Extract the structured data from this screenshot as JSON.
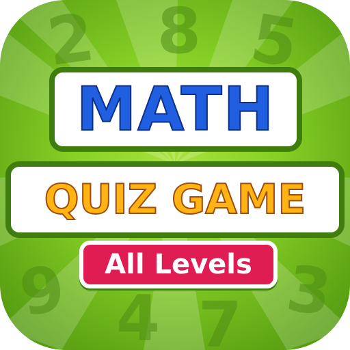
{
  "title": {
    "main": "MATH",
    "sub": "QUIZ GAME"
  },
  "badge": {
    "label": "All Levels"
  },
  "background_digits": [
    "2",
    "8",
    "5",
    "9",
    "4",
    "7",
    "3"
  ],
  "colors": {
    "background_green": "#86cf25",
    "panel_border": "#3f7e0e",
    "math_blue": "#1f5fe0",
    "quiz_orange": "#ffb413",
    "badge_red": "#df1d52"
  }
}
